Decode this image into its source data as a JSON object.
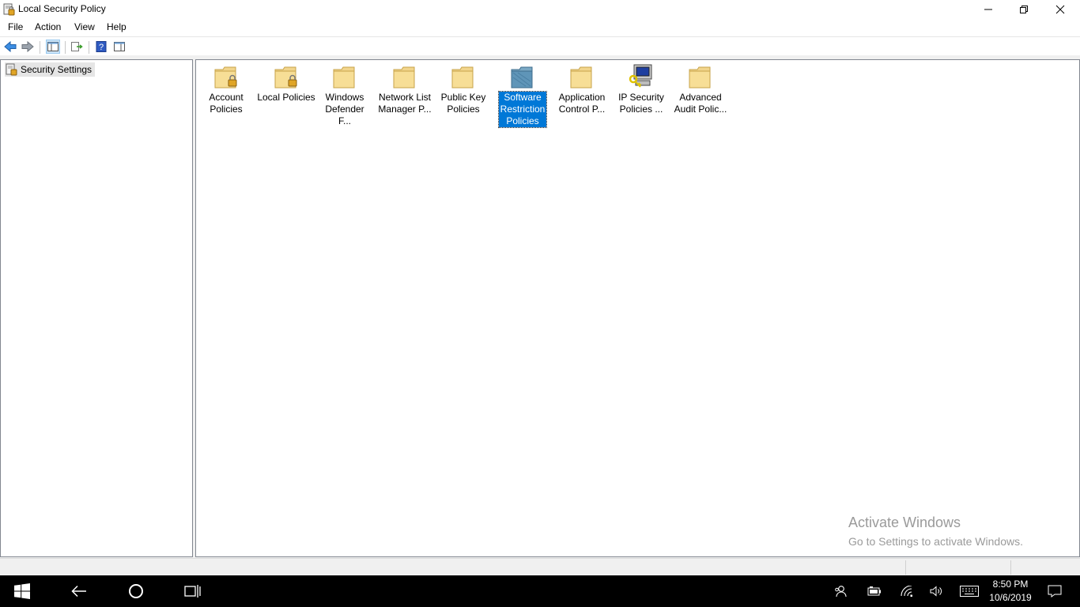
{
  "window": {
    "title": "Local Security Policy",
    "icons": {
      "app": "policy-app-icon",
      "minimize": "minimize-icon",
      "restore": "restore-icon",
      "close": "close-icon"
    }
  },
  "menu": [
    "File",
    "Action",
    "View",
    "Help"
  ],
  "toolbar": {
    "buttons": [
      "back-arrow-icon",
      "forward-arrow-icon",
      "show-hide-tree-icon",
      "export-list-icon",
      "help-icon",
      "properties-view-icon"
    ]
  },
  "tree": {
    "root_label": "Security Settings",
    "icon": "security-settings-icon"
  },
  "list": {
    "items": [
      {
        "line1": "Account",
        "line2": "Policies",
        "line3": "",
        "icon": "locked-folder-icon"
      },
      {
        "line1": "Local Policies",
        "line2": "",
        "line3": "",
        "icon": "locked-folder-icon"
      },
      {
        "line1": "Windows",
        "line2": "Defender F...",
        "line3": "",
        "icon": "folder-icon"
      },
      {
        "line1": "Network List",
        "line2": "Manager P...",
        "line3": "",
        "icon": "folder-icon"
      },
      {
        "line1": "Public Key",
        "line2": "Policies",
        "line3": "",
        "icon": "folder-icon"
      },
      {
        "line1": "Software",
        "line2": "Restriction",
        "line3": "Policies",
        "icon": "software-restriction-icon",
        "selected": true
      },
      {
        "line1": "Application",
        "line2": "Control P...",
        "line3": "",
        "icon": "folder-icon"
      },
      {
        "line1": "IP Security",
        "line2": "Policies ...",
        "line3": "",
        "icon": "ip-security-computer-icon"
      },
      {
        "line1": "Advanced",
        "line2": "Audit Polic...",
        "line3": "",
        "icon": "folder-icon"
      }
    ],
    "selected_color": "#0078d7"
  },
  "watermark": {
    "title": "Activate Windows",
    "subtitle": "Go to Settings to activate Windows."
  },
  "taskbar": {
    "icons": [
      "windows-start-icon",
      "back-arrow-icon",
      "cortana-circle-icon",
      "task-view-icon",
      "people-icon",
      "battery-icon",
      "wifi-icon",
      "volume-icon",
      "keyboard-icon",
      "action-center-icon"
    ],
    "time": "8:50 PM",
    "date": "10/6/2019"
  }
}
